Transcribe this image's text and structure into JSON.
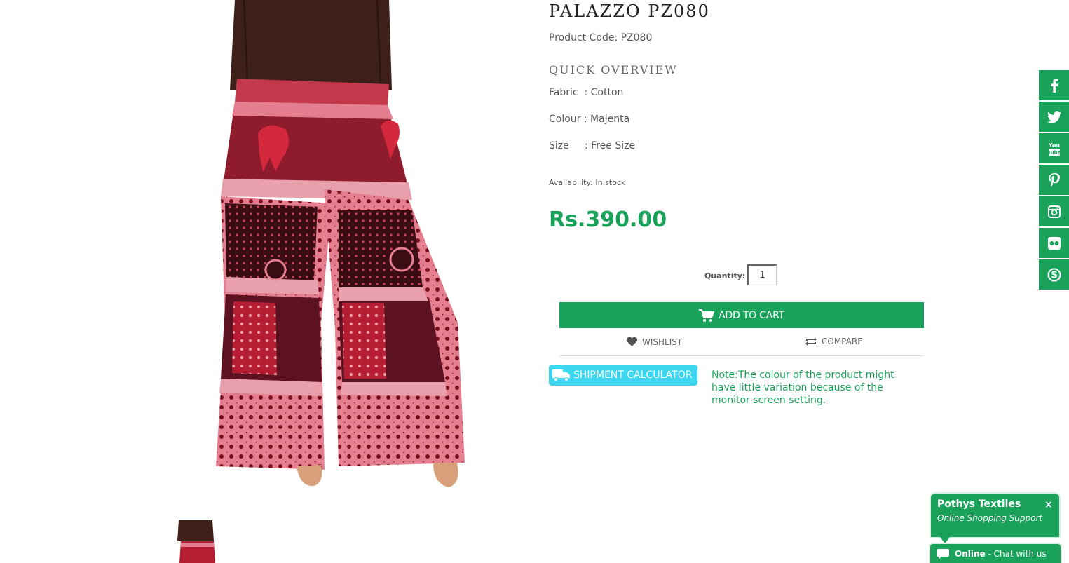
{
  "product": {
    "title": "PALAZZO PZ080",
    "code_line": "Product Code: PZ080",
    "quick_overview_heading": "QUICK OVERVIEW",
    "specs": [
      "Fabric  : Cotton",
      "Colour : Majenta",
      "Size     : Free Size"
    ],
    "availability": "Availability: In stock",
    "price": "Rs.390.00"
  },
  "cart": {
    "quantity_label": "Quantity:",
    "quantity_value": "1",
    "add_to_cart_label": "ADD TO CART",
    "wishlist_label": "WISHLIST",
    "compare_label": "COMPARE"
  },
  "shipping": {
    "button_label": "SHIPMENT CALCULATOR",
    "note": "Note:The colour of the product might have little variation because of the monitor screen setting."
  },
  "social_icons": [
    "facebook-icon",
    "twitter-icon",
    "youtube-icon",
    "pinterest-icon",
    "instagram-icon",
    "flickr-icon",
    "skype-icon"
  ],
  "chat": {
    "title": "Pothys Textiles",
    "subtitle": "Online Shopping Support",
    "close_glyph": "×",
    "status_label": "Online",
    "status_text": " - Chat with us"
  },
  "colors": {
    "brand_green": "#1aa15a",
    "shipment_button": "#3dd6ee",
    "top_brown": "#3b1f1a",
    "pant_red": "#b0202f",
    "pant_pink": "#e27a8c"
  }
}
